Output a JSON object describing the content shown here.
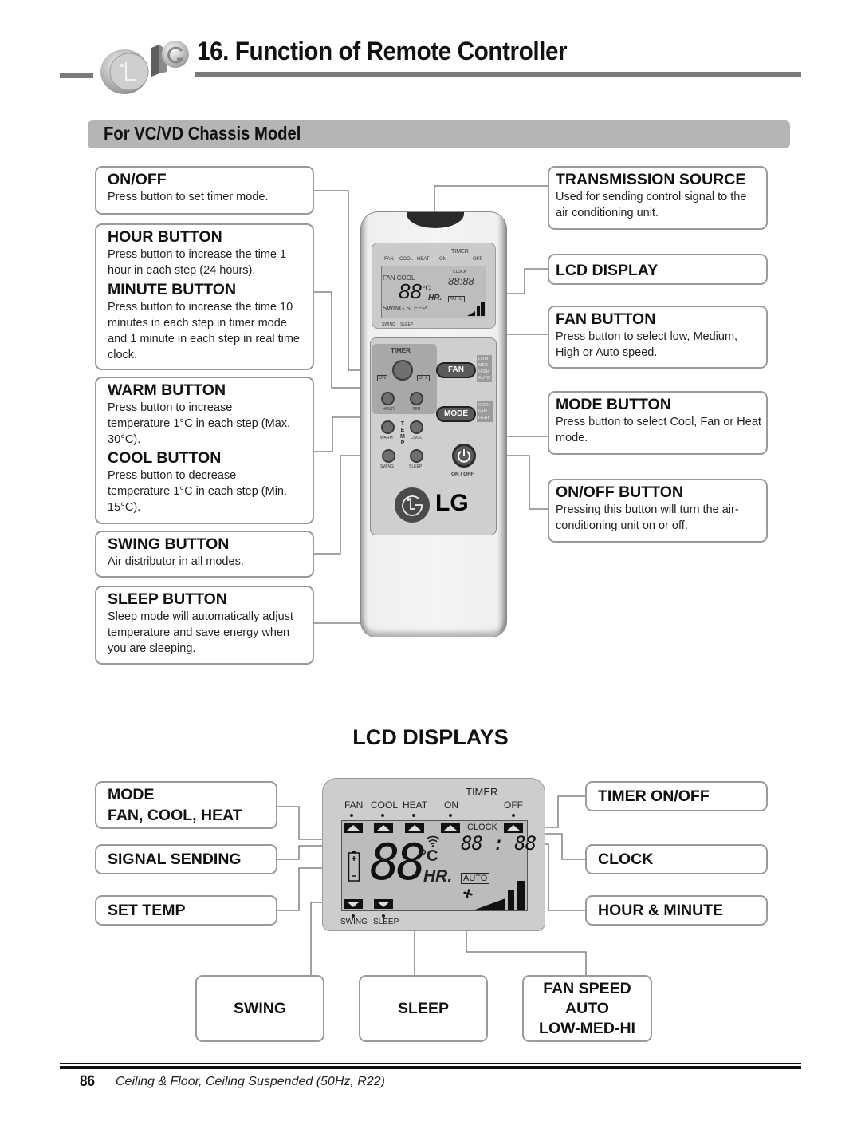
{
  "header": {
    "title": "16. Function of Remote Controller",
    "logo_icon": "lg-3d-logo-icon"
  },
  "section": {
    "title": "For VC/VD Chassis Model"
  },
  "left_callouts": [
    {
      "title": "ON/OFF",
      "desc": "Press button to set timer mode."
    },
    {
      "title": "HOUR BUTTON",
      "desc": "Press button to increase the time 1 hour in each step (24 hours).",
      "title2": "MINUTE BUTTON",
      "desc2": "Press button to increase the time 10 minutes in each step in timer mode and 1 minute in each step in real time clock."
    },
    {
      "title": "WARM BUTTON",
      "desc": "Press button to increase temperature 1°C in each step (Max. 30°C).",
      "title2": "COOL BUTTON",
      "desc2": "Press button to decrease temperature 1°C in each step (Min. 15°C)."
    },
    {
      "title": "SWING BUTTON",
      "desc": "Air distributor in all modes."
    },
    {
      "title": "SLEEP BUTTON",
      "desc": "Sleep mode will automatically adjust temperature and save energy when you are sleeping."
    }
  ],
  "right_callouts": [
    {
      "title": "TRANSMISSION SOURCE",
      "desc": "Used for sending control signal to the air conditioning unit."
    },
    {
      "title": "LCD DISPLAY",
      "desc": ""
    },
    {
      "title": "FAN BUTTON",
      "desc": "Press button to select low, Medium, High or Auto speed."
    },
    {
      "title": "MODE BUTTON",
      "desc": "Press button to select Cool, Fan or Heat mode."
    },
    {
      "title": "ON/OFF BUTTON",
      "desc": "Pressing this button will turn the air-conditioning unit on or off."
    }
  ],
  "remote": {
    "lcd": {
      "timer": "TIMER",
      "top_labels": [
        "FAN",
        "COOL",
        "HEAT",
        "ON",
        "OFF"
      ],
      "mode_text": "FAN COOL",
      "clock": "CLOCK",
      "time": "88:88",
      "temp": "88",
      "unit": "°C",
      "hr": "HR.",
      "auto": "AUTO",
      "bottom_text": "SWING  SLEEP",
      "bottom_labels": [
        "SWING",
        "SLEEP"
      ]
    },
    "timer_label": "TIMER",
    "on_label": "ON",
    "off_label": "OFF",
    "hour_label": "HOUR",
    "min_label": "MIN",
    "fan_label": "FAN",
    "fan_options": [
      "LOW",
      "MED",
      "HIGH",
      "AUTO"
    ],
    "mode_label": "MODE",
    "mode_options": [
      "COOL",
      "FAN",
      "HEAT"
    ],
    "warm_label": "WARM",
    "cool_label": "COOL",
    "temp_letters": [
      "T",
      "E",
      "M",
      "P"
    ],
    "swing_label": "SWING",
    "sleep_label": "SLEEP",
    "onoff_label": "ON / OFF",
    "brand": "LG"
  },
  "lcd_displays": {
    "heading": "LCD DISPLAYS",
    "timer": "TIMER",
    "top_labels": [
      "FAN",
      "COOL",
      "HEAT",
      "ON",
      "OFF"
    ],
    "clock": "CLOCK",
    "time": "88 : 88",
    "temp": "88",
    "unit": "°C",
    "hr": "HR.",
    "auto": "AUTO",
    "bottom_labels": [
      "SWING",
      "SLEEP"
    ],
    "left_labels": [
      {
        "text": "MODE\nFAN, COOL, HEAT",
        "line1": "MODE",
        "line2": "FAN, COOL, HEAT"
      },
      {
        "text": "SIGNAL SENDING"
      },
      {
        "text": "SET TEMP"
      }
    ],
    "right_labels": [
      {
        "text": "TIMER ON/OFF"
      },
      {
        "text": "CLOCK"
      },
      {
        "text": "HOUR & MINUTE"
      }
    ],
    "bottom_boxes": [
      {
        "text": "SWING"
      },
      {
        "text": "SLEEP"
      },
      {
        "line1": "FAN SPEED",
        "line2": "AUTO",
        "line3": "LOW-MED-HI"
      }
    ]
  },
  "footer": {
    "page_number": "86",
    "text": "Ceiling & Floor, Ceiling Suspended (50Hz, R22)"
  }
}
